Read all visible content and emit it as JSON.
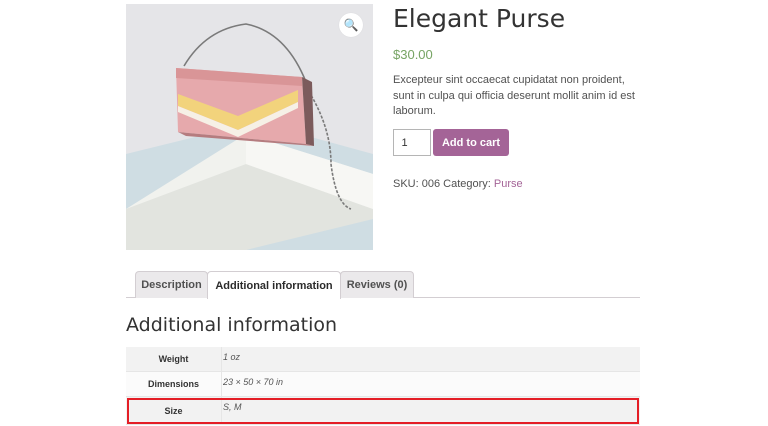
{
  "product": {
    "title": "Elegant Purse",
    "price": "$30.00",
    "description": "Excepteur sint occaecat cupidatat non proident, sunt in culpa qui officia deserunt mollit anim id est laborum.",
    "quantity": "1",
    "add_to_cart_label": "Add to cart",
    "meta_prefix": "SKU: 006 Category: ",
    "category": "Purse",
    "zoom_icon": "magnifier-icon",
    "accent_color": "#a46497",
    "price_color": "#77a464"
  },
  "tabs": [
    {
      "label": "Description",
      "active": false
    },
    {
      "label": "Additional information",
      "active": true
    },
    {
      "label": "Reviews (0)",
      "active": false
    }
  ],
  "additional_info": {
    "title": "Additional information",
    "rows": [
      {
        "label": "Weight",
        "value": "1 oz"
      },
      {
        "label": "Dimensions",
        "value": "23 × 50 × 70 in"
      },
      {
        "label": "Size",
        "value": "S, M"
      }
    ],
    "highlight_color": "#e41e26"
  }
}
